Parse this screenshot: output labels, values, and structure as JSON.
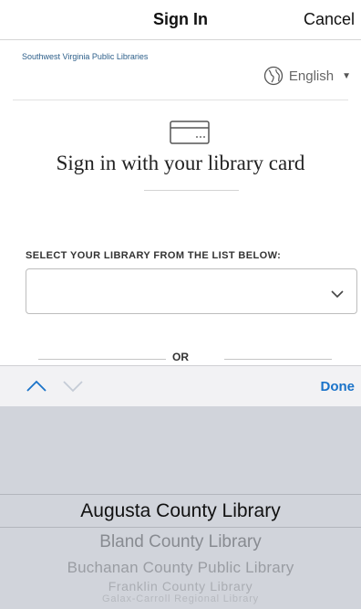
{
  "navbar": {
    "title": "Sign In",
    "cancel_label": "Cancel"
  },
  "library_name": "Southwest Virginia Public Libraries",
  "language": {
    "icon": "globe-icon",
    "label": "English"
  },
  "card_icon": "credit-card-icon",
  "heading": "Sign in with your library card",
  "select": {
    "label": "SELECT YOUR LIBRARY FROM THE LIST BELOW:",
    "value": ""
  },
  "divider_text": "OR",
  "toolbar": {
    "done_label": "Done"
  },
  "picker": {
    "items": [
      "Augusta County Library",
      "Bland County Library",
      "Buchanan County Public Library",
      "Franklin County Library",
      "Galax-Carroll Regional Library"
    ],
    "selected_index": 0
  },
  "colors": {
    "accent": "#1a73c9",
    "link": "#2d5f8a",
    "picker_bg": "#d1d4db"
  }
}
